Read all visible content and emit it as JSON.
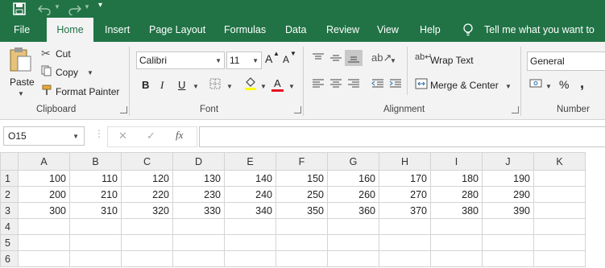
{
  "tabs": [
    "File",
    "Home",
    "Insert",
    "Page Layout",
    "Formulas",
    "Data",
    "Review",
    "View",
    "Help"
  ],
  "active_tab": "Home",
  "tell_me": "Tell me what you want to do",
  "clipboard": {
    "paste": "Paste",
    "cut": "Cut",
    "copy": "Copy",
    "format_painter": "Format Painter",
    "label": "Clipboard"
  },
  "font": {
    "name": "Calibri",
    "size": "11",
    "grow": "A",
    "shrink": "A",
    "bold": "B",
    "italic": "I",
    "underline": "U",
    "color_a": "A",
    "label": "Font"
  },
  "alignment": {
    "wrap_text": "Wrap Text",
    "merge_center": "Merge & Center",
    "label": "Alignment"
  },
  "number": {
    "format": "General",
    "percent": "%",
    "comma": ",",
    "label": "Number"
  },
  "formula_bar": {
    "name_box": "O15",
    "cancel": "✕",
    "enter": "✓",
    "fx": "fx",
    "value": ""
  },
  "columns": [
    "A",
    "B",
    "C",
    "D",
    "E",
    "F",
    "G",
    "H",
    "I",
    "J",
    "K"
  ],
  "rows": [
    {
      "num": "1",
      "cells": [
        "100",
        "110",
        "120",
        "130",
        "140",
        "150",
        "160",
        "170",
        "180",
        "190",
        ""
      ]
    },
    {
      "num": "2",
      "cells": [
        "200",
        "210",
        "220",
        "230",
        "240",
        "250",
        "260",
        "270",
        "280",
        "290",
        ""
      ]
    },
    {
      "num": "3",
      "cells": [
        "300",
        "310",
        "320",
        "330",
        "340",
        "350",
        "360",
        "370",
        "380",
        "390",
        ""
      ]
    },
    {
      "num": "4",
      "cells": [
        "",
        "",
        "",
        "",
        "",
        "",
        "",
        "",
        "",
        "",
        ""
      ]
    },
    {
      "num": "5",
      "cells": [
        "",
        "",
        "",
        "",
        "",
        "",
        "",
        "",
        "",
        "",
        ""
      ]
    },
    {
      "num": "6",
      "cells": [
        "",
        "",
        "",
        "",
        "",
        "",
        "",
        "",
        "",
        "",
        ""
      ]
    }
  ],
  "colors": {
    "brand": "#217346",
    "highlight": "#ffff00",
    "font_color": "#e81123"
  }
}
